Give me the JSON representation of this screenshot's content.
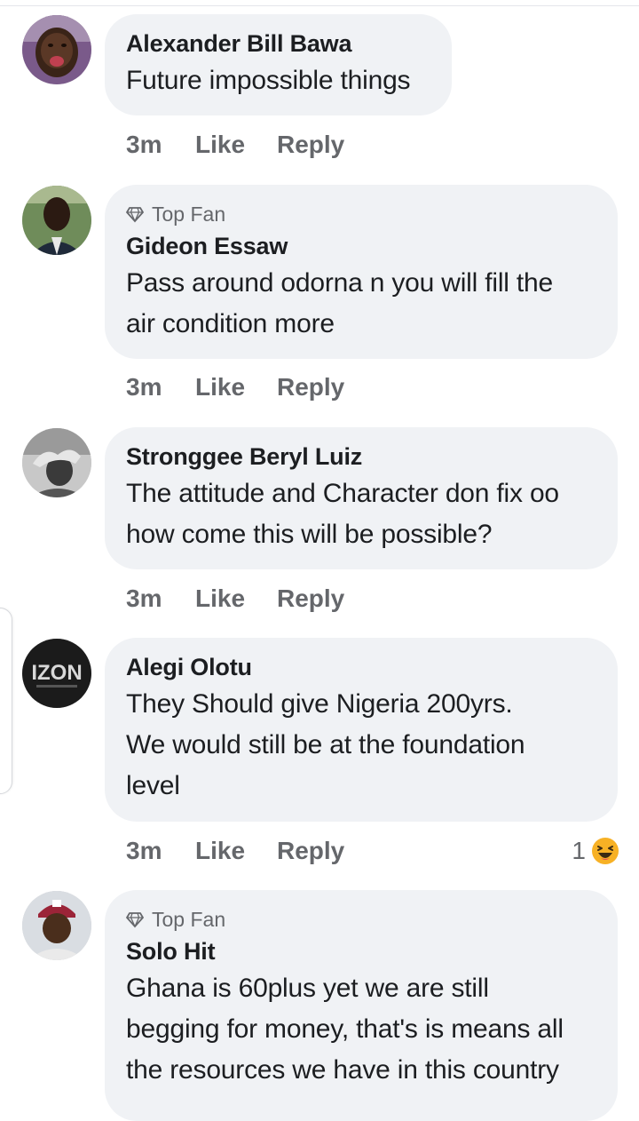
{
  "comments": [
    {
      "author": "Alexander Bill Bawa",
      "badge": "",
      "text_lines": [
        "Future impossible things"
      ],
      "time": "3m",
      "like": "Like",
      "reply": "Reply",
      "reaction_count": ""
    },
    {
      "author": "Gideon Essaw",
      "badge": "Top Fan",
      "text_lines": [
        "Pass around odorna  n you will fill the",
        "air condition more"
      ],
      "time": "3m",
      "like": "Like",
      "reply": "Reply",
      "reaction_count": ""
    },
    {
      "author": "Stronggee Beryl Luiz",
      "badge": "",
      "text_lines": [
        "The attitude and Character don fix oo",
        "how come this will be possible?"
      ],
      "time": "3m",
      "like": "Like",
      "reply": "Reply",
      "reaction_count": ""
    },
    {
      "author": "Alegi Olotu",
      "badge": "",
      "text_lines": [
        "They Should give Nigeria 200yrs.",
        "We would still be at the foundation",
        "level"
      ],
      "time": "3m",
      "like": "Like",
      "reply": "Reply",
      "reaction_count": "1",
      "reaction_icon": "haha-emoji-icon",
      "avatar_text": "IZON"
    },
    {
      "author": "Solo Hit",
      "badge": "Top Fan",
      "text_lines": [
        "Ghana is 60plus yet we are still",
        "begging for money, that's is means all",
        "the resources we have in this country"
      ],
      "time": "",
      "like": "",
      "reply": "",
      "reaction_count": ""
    }
  ],
  "colors": {
    "bubble": "#f0f2f5",
    "secondary_text": "#65676b",
    "primary_text": "#1c1e21"
  }
}
